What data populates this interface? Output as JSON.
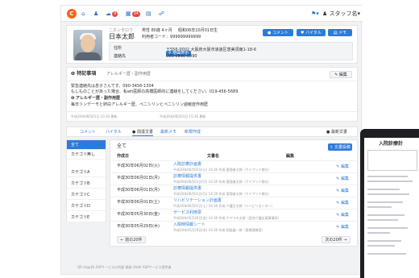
{
  "nav": {
    "items": [
      {
        "icon": "home-icon",
        "glyph": "⌂"
      },
      {
        "icon": "user-icon",
        "glyph": "♟"
      },
      {
        "icon": "cloud-icon",
        "glyph": "☁",
        "badge": "9"
      },
      {
        "icon": "document-icon",
        "glyph": "▦",
        "badge": "34"
      },
      {
        "icon": "chart-icon",
        "glyph": "▤"
      },
      {
        "icon": "team-icon",
        "glyph": "☍"
      }
    ],
    "flag_icon": "⚑",
    "user_label": "スタッフ名"
  },
  "profile": {
    "kana": "ニホンタロウ",
    "name": "日本太郎",
    "gender_age": "男性 80歳 4ヶ月",
    "birth": "昭和06年10月01日生",
    "user_code_label": "利用者コード：",
    "user_code": "999999999999",
    "address_label": "住所",
    "map_tag": "地図表示",
    "address": "〒556-0002 大阪府大阪市浪速区恵美須東1-18-6",
    "phone_label": "連絡先",
    "phone": "090-0990-0990",
    "btn_comment": "コメント",
    "btn_vital": "バイタル",
    "btn_memo": "メモ"
  },
  "notes": {
    "title": "特記事項",
    "subtitle": "アレルギー歴・副作用歴",
    "edit": "✎ 編集",
    "line1": "緊急連絡先は息子さんです。090-3456-1304",
    "line2": "もしものことがあった場合、私wh医師の高橋医師的に連絡をしてください。019-456-5689",
    "allergy_title": "アレルギー歴・副作用歴",
    "allergy_text": "毎日リンデーモと卵白アレルギー歴、ペニシリンとペニシリン過敏症作用歴",
    "meta1": "平成30年08月01日 10:30 更新",
    "meta2": "平成30年08月03日 15:30 更新"
  },
  "tabs": [
    {
      "label": "コメント",
      "active": false
    },
    {
      "label": "バイタル",
      "active": false
    },
    {
      "label": "● 間違文書",
      "active": true
    },
    {
      "label": "最新メモ",
      "active": false
    },
    {
      "label": "新規作成",
      "active": false
    }
  ],
  "tabs_right": "● 最新文書",
  "categories": [
    "全て",
    "カテゴリ無し",
    "カテゴリA",
    "カテゴリB",
    "カテゴリC",
    "カテゴリD",
    "カテゴリE"
  ],
  "main": {
    "header": "全て",
    "upload_btn": "文書投稿",
    "col_date": "作成日",
    "col_doc": "文書名",
    "col_edit": "編集",
    "rows": [
      {
        "date": "平成30年06月02日(火)",
        "doc": "入院診療計画書",
        "meta": "平成30年06月02日(火) 14:30 作成  管理者太郎（ケイアンド商社）",
        "edit": "✎ 編集"
      },
      {
        "date": "平成30年06月01日(月)",
        "doc": "診療情報提供書",
        "meta": "平成30年06月01日(月) 14:30 作成  管理者太郎（ケイアンド商社）",
        "edit": "✎ 編集"
      },
      {
        "date": "平成30年06月01日(月)",
        "doc": "診療情報提供書",
        "meta": "平成30年06月01日(月) 14:30 作成  管理者太郎（ケイアンド商社）",
        "edit": "✎ 編集"
      },
      {
        "date": "平成30年06月01日(土)",
        "doc": "リハビリテーション計画書",
        "meta": "平成30年06月01日(土) 16:30 作成  介護主太郎（リハビリセンター）",
        "edit": "✎ 編集"
      },
      {
        "date": "平成30年05月30日(金)",
        "doc": "サービス利用票",
        "meta": "平成30年05月30日(金) 14:30 作成  ケアマネ太郎（居宅介護支援事業所）",
        "edit": "✎ 編集"
      },
      {
        "date": "平成30年05月29日(木)",
        "doc": "入院時情報シート",
        "meta": "平成30年05月29日(木) 14:30 作成  相談員一郎（医療連携室）",
        "edit": "✎ 編集"
      }
    ],
    "prev": "← 前の20件",
    "next": "次の20件 →"
  },
  "footer": "QR (AppD) ASPサービスの所要  開発 (Add) ASPサービス提供者",
  "tablet": {
    "title": "入院診療計"
  }
}
